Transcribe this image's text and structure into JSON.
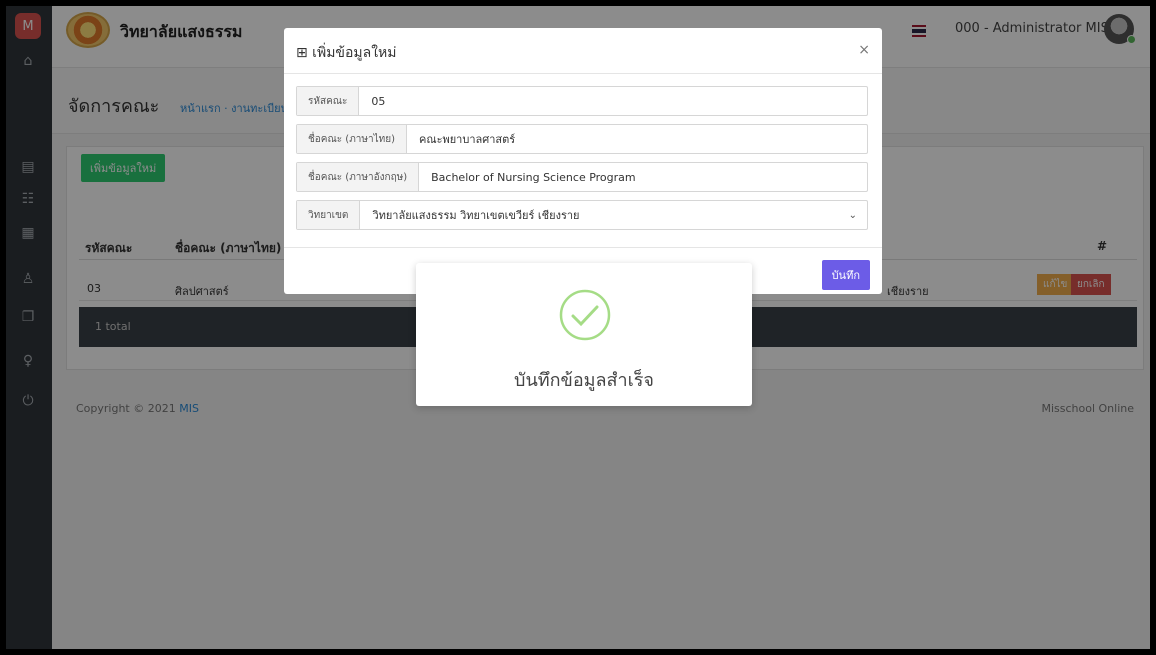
{
  "sidebar": {
    "logo_letter": "M",
    "icons": [
      "home-icon",
      "document-icon",
      "users-group-icon",
      "book-icon",
      "person-icon",
      "file-icon",
      "user-circle-icon",
      "logout-icon"
    ]
  },
  "header": {
    "college_name": "วิทยาลัยแสงธรรม",
    "user_name": "000 - Administrator MIS"
  },
  "page": {
    "title": "จัดการคณะ",
    "breadcrumb": "หน้าแรก · งานทะเบียน",
    "add_button": "เพิ่มข้อมูลใหม่"
  },
  "table": {
    "columns": [
      "รหัสคณะ",
      "ชื่อคณะ (ภาษาไทย)",
      "#"
    ],
    "rows": [
      {
        "code": "03",
        "name_th": "ศิลปศาสตร์",
        "campus_tail": "เชียงราย",
        "edit": "แก้ไข",
        "cancel": "ยกเลิก"
      }
    ],
    "total_text": "1 total"
  },
  "footer": {
    "copyright_prefix": "Copyright © 2021",
    "copyright_link": "MIS",
    "right": "Misschool Online"
  },
  "modal": {
    "title": "⊞ เพิ่มข้อมูลใหม่",
    "close": "×",
    "fields": [
      {
        "label": "รหัสคณะ",
        "value": "05"
      },
      {
        "label": "ชื่อคณะ (ภาษาไทย)",
        "value": "คณะพยาบาลศาสตร์"
      },
      {
        "label": "ชื่อคณะ (ภาษาอังกฤษ)",
        "value": "Bachelor of Nursing Science Program"
      },
      {
        "label": "วิทยาเขต",
        "value": "วิทยาลัยแสงธรรม วิทยาเขตเขวียร์ เชียงราย"
      }
    ],
    "save_button": "บันทึก"
  },
  "alert": {
    "message": "บันทึกข้อมูลสำเร็จ"
  },
  "colors": {
    "sidebar": "#30353b",
    "success": "#a5dc86",
    "add_button": "#2ecc71",
    "save_button": "#6c5ce7"
  }
}
